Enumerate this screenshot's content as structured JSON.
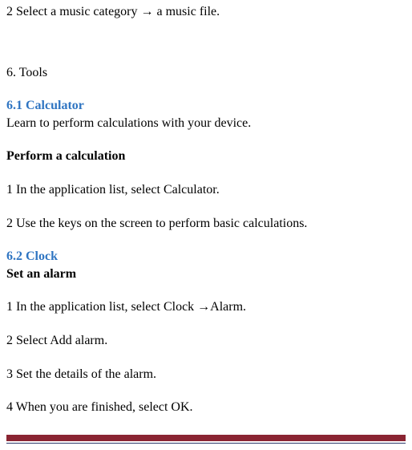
{
  "top_step": "2 Select a music category → a music file.",
  "section_title": "6. Tools",
  "calculator": {
    "heading": "6.1 Calculator",
    "intro": "Learn to perform calculations with your device.",
    "subhead": "Perform a calculation",
    "steps": [
      "1 In the application list, select Calculator.",
      "2 Use the keys on the screen to perform basic calculations."
    ]
  },
  "clock": {
    "heading": "6.2 Clock",
    "subhead": "Set an alarm",
    "steps": [
      "1 In the application list, select Clock →Alarm.",
      "2 Select Add alarm.",
      "3 Set the details of the alarm.",
      "4 When you are finished, select OK."
    ]
  }
}
